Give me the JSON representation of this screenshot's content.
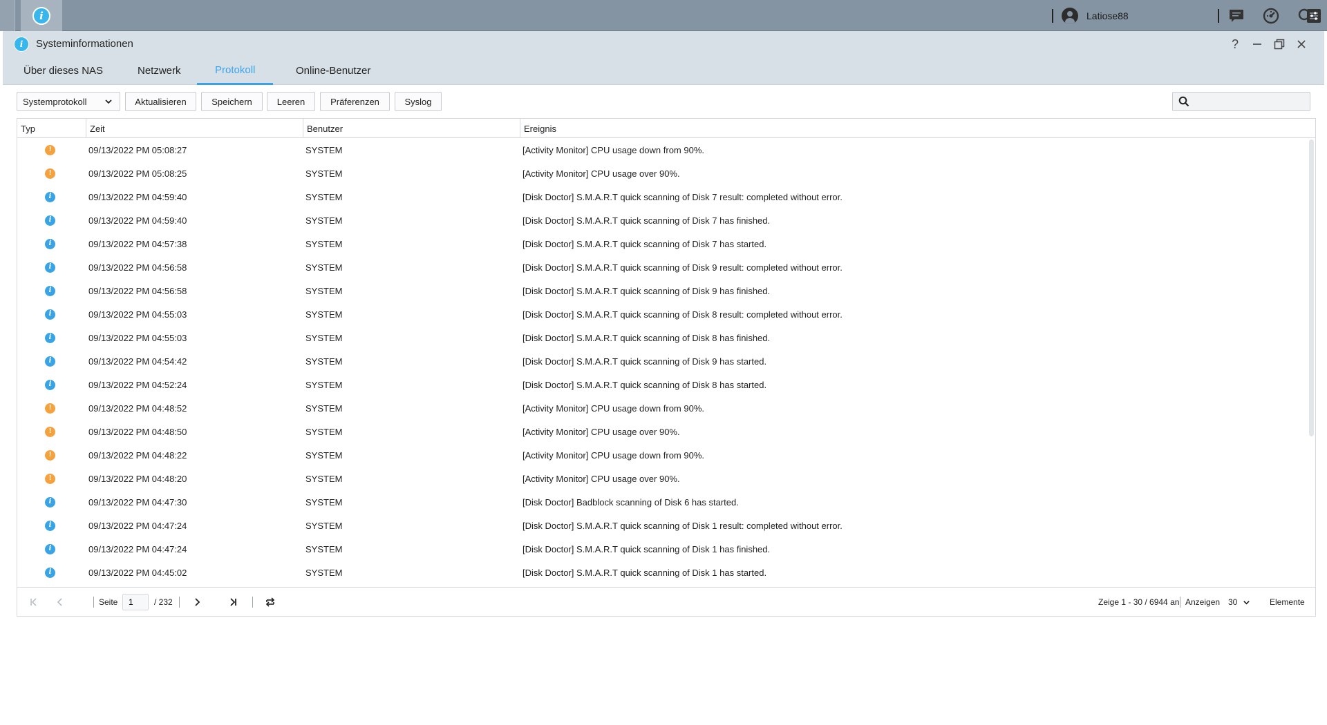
{
  "taskbar": {
    "app_icon": "info-icon",
    "username": "Latiose88",
    "icons": [
      "user-icon",
      "notification-icon",
      "dashboard-icon",
      "search-icon",
      "settings-icon"
    ]
  },
  "window": {
    "title": "Systeminformationen",
    "controls": [
      "help-icon",
      "minimize-icon",
      "restore-icon",
      "close-icon"
    ]
  },
  "tabs": [
    {
      "label": "Über dieses NAS",
      "active": false
    },
    {
      "label": "Netzwerk",
      "active": false
    },
    {
      "label": "Protokoll",
      "active": true
    },
    {
      "label": "Online-Benutzer",
      "active": false
    }
  ],
  "toolbar": {
    "log_select": "Systemprotokoll",
    "refresh": "Aktualisieren",
    "save": "Speichern",
    "clear": "Leeren",
    "preferences": "Präferenzen",
    "syslog": "Syslog",
    "search_value": ""
  },
  "grid": {
    "headers": {
      "type": "Typ",
      "time": "Zeit",
      "user": "Benutzer",
      "event": "Ereignis"
    },
    "rows": [
      {
        "type": "warning",
        "time": "09/13/2022 PM 05:08:27",
        "user": "SYSTEM",
        "event": "[Activity Monitor] CPU usage down from 90%."
      },
      {
        "type": "warning",
        "time": "09/13/2022 PM 05:08:25",
        "user": "SYSTEM",
        "event": "[Activity Monitor] CPU usage over 90%."
      },
      {
        "type": "info",
        "time": "09/13/2022 PM 04:59:40",
        "user": "SYSTEM",
        "event": "[Disk Doctor] S.M.A.R.T quick scanning of Disk 7 result: completed without error."
      },
      {
        "type": "info",
        "time": "09/13/2022 PM 04:59:40",
        "user": "SYSTEM",
        "event": "[Disk Doctor] S.M.A.R.T quick scanning of Disk 7 has finished."
      },
      {
        "type": "info",
        "time": "09/13/2022 PM 04:57:38",
        "user": "SYSTEM",
        "event": "[Disk Doctor] S.M.A.R.T quick scanning of Disk 7 has started."
      },
      {
        "type": "info",
        "time": "09/13/2022 PM 04:56:58",
        "user": "SYSTEM",
        "event": "[Disk Doctor] S.M.A.R.T quick scanning of Disk 9 result: completed without error."
      },
      {
        "type": "info",
        "time": "09/13/2022 PM 04:56:58",
        "user": "SYSTEM",
        "event": "[Disk Doctor] S.M.A.R.T quick scanning of Disk 9 has finished."
      },
      {
        "type": "info",
        "time": "09/13/2022 PM 04:55:03",
        "user": "SYSTEM",
        "event": "[Disk Doctor] S.M.A.R.T quick scanning of Disk 8 result: completed without error."
      },
      {
        "type": "info",
        "time": "09/13/2022 PM 04:55:03",
        "user": "SYSTEM",
        "event": "[Disk Doctor] S.M.A.R.T quick scanning of Disk 8 has finished."
      },
      {
        "type": "info",
        "time": "09/13/2022 PM 04:54:42",
        "user": "SYSTEM",
        "event": "[Disk Doctor] S.M.A.R.T quick scanning of Disk 9 has started."
      },
      {
        "type": "info",
        "time": "09/13/2022 PM 04:52:24",
        "user": "SYSTEM",
        "event": "[Disk Doctor] S.M.A.R.T quick scanning of Disk 8 has started."
      },
      {
        "type": "warning",
        "time": "09/13/2022 PM 04:48:52",
        "user": "SYSTEM",
        "event": "[Activity Monitor] CPU usage down from 90%."
      },
      {
        "type": "warning",
        "time": "09/13/2022 PM 04:48:50",
        "user": "SYSTEM",
        "event": "[Activity Monitor] CPU usage over 90%."
      },
      {
        "type": "warning",
        "time": "09/13/2022 PM 04:48:22",
        "user": "SYSTEM",
        "event": "[Activity Monitor] CPU usage down from 90%."
      },
      {
        "type": "warning",
        "time": "09/13/2022 PM 04:48:20",
        "user": "SYSTEM",
        "event": "[Activity Monitor] CPU usage over 90%."
      },
      {
        "type": "info",
        "time": "09/13/2022 PM 04:47:30",
        "user": "SYSTEM",
        "event": "[Disk Doctor] Badblock scanning of Disk 6 has started."
      },
      {
        "type": "info",
        "time": "09/13/2022 PM 04:47:24",
        "user": "SYSTEM",
        "event": "[Disk Doctor] S.M.A.R.T quick scanning of Disk 1 result: completed without error."
      },
      {
        "type": "info",
        "time": "09/13/2022 PM 04:47:24",
        "user": "SYSTEM",
        "event": "[Disk Doctor] S.M.A.R.T quick scanning of Disk 1 has finished."
      },
      {
        "type": "info",
        "time": "09/13/2022 PM 04:45:02",
        "user": "SYSTEM",
        "event": "[Disk Doctor] S.M.A.R.T quick scanning of Disk 1 has started."
      }
    ]
  },
  "pager": {
    "page_label": "Seite",
    "page_value": "1",
    "page_total": "/ 232",
    "summary": "Zeige 1 - 30 / 6944 an",
    "show_label": "Anzeigen",
    "page_size": "30",
    "items_label": "Elemente"
  },
  "colors": {
    "accent": "#3ba2e8",
    "warning": "#f4a23e",
    "info": "#38a4e6",
    "taskbar": "#8594a3",
    "titlebar": "#d8e0e7"
  }
}
